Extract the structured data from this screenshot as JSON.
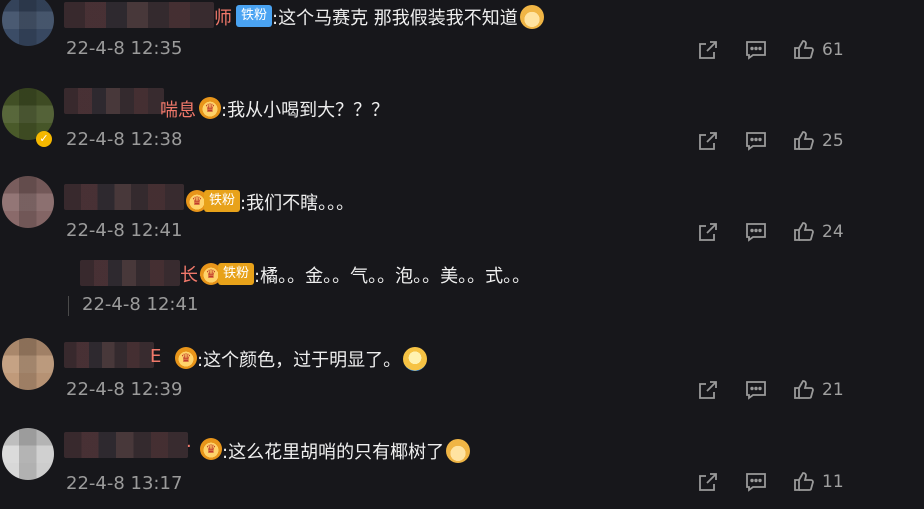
{
  "comments": [
    {
      "name_tail": "师",
      "badge": "铁粉",
      "text": ":这个马赛克 那我假装我不知道",
      "time": "22-4-8 12:35",
      "likes": "61"
    },
    {
      "name_tail": "喘息",
      "text": ":我从小喝到大？？？",
      "time": "22-4-8 12:38",
      "likes": "25"
    },
    {
      "badge": "铁粉",
      "text": ":我们不瞎。。。",
      "time": "22-4-8 12:41",
      "likes": "24"
    },
    {
      "name_tail": "长·",
      "badge": "铁粉",
      "text": ":橘。。金。。气。。泡。。美。。式。。",
      "time": "22-4-8 12:41"
    },
    {
      "name_tail": "E",
      "text": ":这个颜色，过于明显了。",
      "time": "22-4-8 12:39",
      "likes": "21"
    },
    {
      "name_tail": "·",
      "text": ":这么花里胡哨的只有椰树了",
      "time": "22-4-8 13:17",
      "likes": "11"
    }
  ],
  "icons": {
    "share": "share-icon",
    "comment": "comment-icon",
    "like": "thumbs-up-icon",
    "crown": "crown-icon",
    "verified": "verified-icon"
  }
}
